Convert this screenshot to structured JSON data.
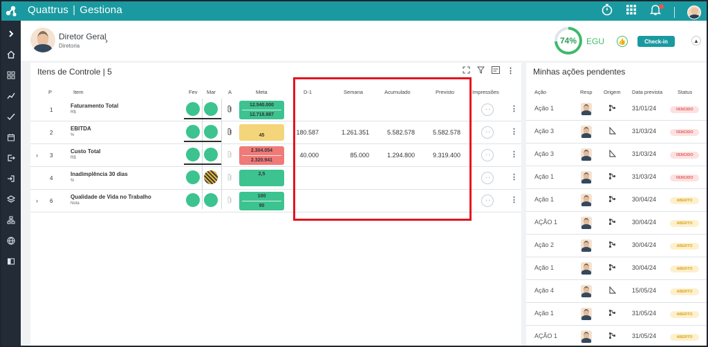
{
  "app": {
    "brand_name": "Quattrus",
    "brand_product": "Gestiona",
    "brand_sep": "|"
  },
  "topbar": {
    "icons": [
      "stopwatch-icon",
      "apps-grid-icon",
      "bell-icon",
      "user-avatar"
    ]
  },
  "sidebar": {
    "items": [
      "chevron-right-icon",
      "home-icon",
      "dashboard-icon",
      "trend-icon",
      "check-icon",
      "calendar-icon",
      "export-icon",
      "exit-icon",
      "layers-icon",
      "org-chart-icon",
      "globe-icon",
      "book-icon"
    ]
  },
  "user": {
    "name": "Diretor Geral",
    "role": "Diretoria",
    "score": "74%",
    "score_value": 0.74,
    "score_label": "EGU",
    "checkin_label": "Check-in"
  },
  "control": {
    "title": "Itens de Controle | 5",
    "headers": {
      "p": "P",
      "item": "Item",
      "fev": "Fev",
      "mar": "Mar",
      "a": "A",
      "meta": "Meta",
      "d1": "D-1",
      "semana": "Semana",
      "acumulado": "Acumulado",
      "previsto": "Previsto",
      "impressoes": "Impressões"
    },
    "rows": [
      {
        "p": "1",
        "name": "Faturamento Total",
        "unit": "R$",
        "fev": "green",
        "mar": "green",
        "meta_top": "12.540.000",
        "meta_bottom": "12.718.887",
        "meta_color": "#3cc390",
        "d1": "",
        "semana": "",
        "acumulado": "",
        "previsto": "",
        "expandable": false,
        "attach": true
      },
      {
        "p": "2",
        "name": "EBITDA",
        "unit": "%",
        "fev": "green",
        "mar": "green",
        "meta_top": "",
        "meta_bottom": "45",
        "meta_color": "#f5d57a",
        "d1": "180.587",
        "semana": "1.261.351",
        "acumulado": "5.582.578",
        "previsto": "5.582.578",
        "expandable": false,
        "attach": true
      },
      {
        "p": "3",
        "name": "Custo Total",
        "unit": "R$",
        "fev": "green",
        "mar": "green",
        "meta_top": "2.304.054",
        "meta_bottom": "2.320.941",
        "meta_color": "#f07a78",
        "d1": "40.000",
        "semana": "85.000",
        "acumulado": "1.294.800",
        "previsto": "9.319.400",
        "expandable": true,
        "attach": false
      },
      {
        "p": "4",
        "name": "Inadimplência 30 dias",
        "unit": "%",
        "fev": "green",
        "mar": "hatch",
        "meta_top": "2,5",
        "meta_bottom": "",
        "meta_color": "#3cc390",
        "d1": "",
        "semana": "",
        "acumulado": "",
        "previsto": "",
        "expandable": false,
        "attach": false
      },
      {
        "p": "6",
        "name": "Qualidade de Vida no Trabalho",
        "unit": "Nota",
        "fev": "green",
        "mar": "green",
        "meta_top": "100",
        "meta_bottom": "90",
        "meta_color": "#3cc390",
        "d1": "",
        "semana": "",
        "acumulado": "",
        "previsto": "",
        "expandable": true,
        "attach": false
      }
    ]
  },
  "actions": {
    "title": "Minhas ações pendentes",
    "headers": {
      "acao": "Ação",
      "resp": "Resp",
      "origem": "Origem",
      "data": "Data prevista",
      "status": "Status"
    },
    "rows": [
      {
        "acao": "Ação 1",
        "origem": "org",
        "data": "31/01/24",
        "status": "VENCIDO",
        "kind": "vencido"
      },
      {
        "acao": "Ação 3",
        "origem": "tri",
        "data": "31/03/24",
        "status": "VENCIDO",
        "kind": "vencido"
      },
      {
        "acao": "Ação 3",
        "origem": "tri",
        "data": "31/03/24",
        "status": "VENCIDO",
        "kind": "vencido"
      },
      {
        "acao": "Ação 1",
        "origem": "org",
        "data": "31/03/24",
        "status": "VENCIDO",
        "kind": "vencido"
      },
      {
        "acao": "Ação 1",
        "origem": "org",
        "data": "30/04/24",
        "status": "ABERTO",
        "kind": "aberto"
      },
      {
        "acao": "AÇÃO 1",
        "origem": "org",
        "data": "30/04/24",
        "status": "ABERTO",
        "kind": "aberto"
      },
      {
        "acao": "Ação 2",
        "origem": "org",
        "data": "30/04/24",
        "status": "ABERTO",
        "kind": "aberto"
      },
      {
        "acao": "Ação 1",
        "origem": "org",
        "data": "30/04/24",
        "status": "ABERTO",
        "kind": "aberto"
      },
      {
        "acao": "Ação 4",
        "origem": "tri",
        "data": "15/05/24",
        "status": "ABERTO",
        "kind": "aberto"
      },
      {
        "acao": "Ação 1",
        "origem": "org",
        "data": "31/05/24",
        "status": "ABERTO",
        "kind": "aberto"
      },
      {
        "acao": "AÇÃO 1",
        "origem": "org",
        "data": "31/05/24",
        "status": "ABERTO",
        "kind": "aberto"
      }
    ]
  }
}
